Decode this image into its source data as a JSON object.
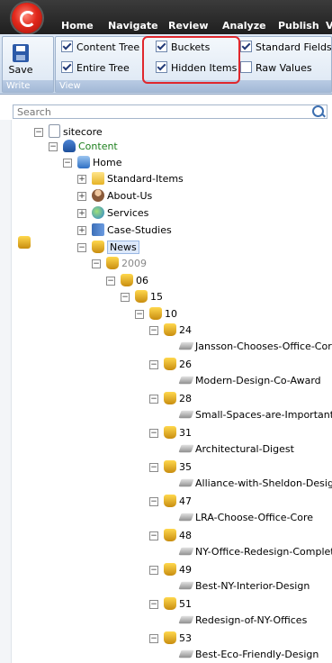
{
  "tabs": [
    "Home",
    "Navigate",
    "Review",
    "Analyze",
    "Publish",
    "V"
  ],
  "ribbon": {
    "write_group": {
      "save_label": "Save",
      "group_label": "Write"
    },
    "view_group": {
      "group_label": "View",
      "checkboxes": [
        {
          "label": "Content Tree",
          "checked": true
        },
        {
          "label": "Entire Tree",
          "checked": true
        },
        {
          "label": "Buckets",
          "checked": true
        },
        {
          "label": "Hidden Items",
          "checked": true
        },
        {
          "label": "Standard Fields",
          "checked": true
        },
        {
          "label": "Raw Values",
          "checked": false
        }
      ]
    }
  },
  "search": {
    "placeholder": "Search"
  },
  "tree": [
    {
      "label": "sitecore",
      "icon": "page-icon",
      "expander": "minus"
    },
    {
      "label": "Content",
      "icon": "database-icon",
      "expander": "minus"
    },
    {
      "label": "Home",
      "icon": "home-icon",
      "expander": "minus"
    },
    {
      "label": "Standard-Items",
      "icon": "folder-icon",
      "expander": "plus"
    },
    {
      "label": "About-Us",
      "icon": "person-icon",
      "expander": "plus"
    },
    {
      "label": "Services",
      "icon": "globe-icon",
      "expander": "plus"
    },
    {
      "label": "Case-Studies",
      "icon": "book-icon",
      "expander": "plus"
    },
    {
      "label": "News",
      "icon": "bucket-icon",
      "expander": "minus"
    },
    {
      "label": "2009",
      "icon": "bucket-icon",
      "expander": "minus"
    },
    {
      "label": "06",
      "icon": "bucket-icon",
      "expander": "minus"
    },
    {
      "label": "15",
      "icon": "bucket-icon",
      "expander": "minus"
    },
    {
      "label": "10",
      "icon": "bucket-icon",
      "expander": "minus"
    },
    {
      "label": "24",
      "icon": "bucket-icon",
      "expander": "minus"
    },
    {
      "label": "Jansson-Chooses-Office-Core",
      "icon": "item-icon",
      "expander": "none"
    },
    {
      "label": "26",
      "icon": "bucket-icon",
      "expander": "minus"
    },
    {
      "label": "Modern-Design-Co-Award",
      "icon": "item-icon",
      "expander": "none"
    },
    {
      "label": "28",
      "icon": "bucket-icon",
      "expander": "minus"
    },
    {
      "label": "Small-Spaces-are-Important",
      "icon": "item-icon",
      "expander": "none"
    },
    {
      "label": "31",
      "icon": "bucket-icon",
      "expander": "minus"
    },
    {
      "label": "Architectural-Digest",
      "icon": "item-icon",
      "expander": "none"
    },
    {
      "label": "35",
      "icon": "bucket-icon",
      "expander": "minus"
    },
    {
      "label": "Alliance-with-Sheldon-Designs",
      "icon": "item-icon",
      "expander": "none"
    },
    {
      "label": "47",
      "icon": "bucket-icon",
      "expander": "minus"
    },
    {
      "label": "LRA-Choose-Office-Core",
      "icon": "item-icon",
      "expander": "none"
    },
    {
      "label": "48",
      "icon": "bucket-icon",
      "expander": "minus"
    },
    {
      "label": "NY-Office-Redesign-Complete",
      "icon": "item-icon",
      "expander": "none"
    },
    {
      "label": "49",
      "icon": "bucket-icon",
      "expander": "minus"
    },
    {
      "label": "Best-NY-Interior-Design",
      "icon": "item-icon",
      "expander": "none"
    },
    {
      "label": "51",
      "icon": "bucket-icon",
      "expander": "minus"
    },
    {
      "label": "Redesign-of-NY-Offices",
      "icon": "item-icon",
      "expander": "none"
    },
    {
      "label": "53",
      "icon": "bucket-icon",
      "expander": "minus"
    },
    {
      "label": "Best-Eco-Friendly-Design",
      "icon": "item-icon",
      "expander": "none"
    }
  ]
}
